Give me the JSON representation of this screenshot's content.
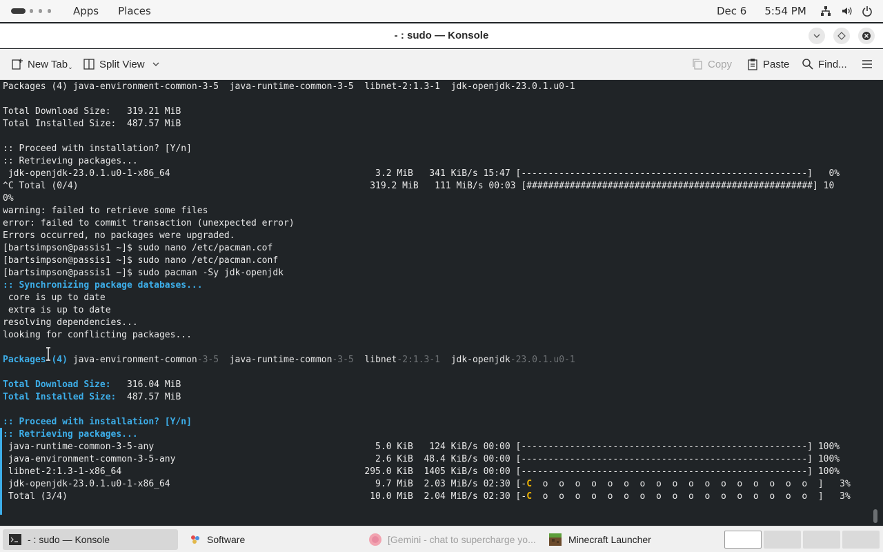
{
  "top_panel": {
    "apps_label": "Apps",
    "places_label": "Places",
    "date": "Dec 6",
    "time": "5:54 PM"
  },
  "window": {
    "title": "- : sudo — Konsole"
  },
  "toolbar": {
    "new_tab": "New Tab",
    "split_view": "Split View",
    "copy": "Copy",
    "paste": "Paste",
    "find": "Find..."
  },
  "terminal": {
    "lines": [
      [
        {
          "t": "Packages (4) java-environment-common-3-5  java-runtime-common-3-5  libnet-2:1.3-1  jdk-openjdk-23.0.1.u0-1"
        }
      ],
      [
        {
          "t": ""
        }
      ],
      [
        {
          "t": "Total Download Size:   319.21 MiB"
        }
      ],
      [
        {
          "t": "Total Installed Size:  487.57 MiB"
        }
      ],
      [
        {
          "t": ""
        }
      ],
      [
        {
          "t": ":: Proceed with installation? [Y/n]"
        }
      ],
      [
        {
          "t": ":: Retrieving packages..."
        }
      ],
      [
        {
          "t": " jdk-openjdk-23.0.1.u0-1-x86_64                                      3.2 MiB   341 KiB/s 15:47 [-----------------------------------------------------]   0%"
        }
      ],
      [
        {
          "t": "^C Total (0/4)                                                      319.2 MiB   111 MiB/s 00:03 [#####################################################] 10"
        }
      ],
      [
        {
          "t": "0%"
        }
      ],
      [
        {
          "t": "warning: failed to retrieve some files"
        }
      ],
      [
        {
          "t": "error: failed to commit transaction (unexpected error)"
        }
      ],
      [
        {
          "t": "Errors occurred, no packages were upgraded."
        }
      ],
      [
        {
          "t": "[bartsimpson@passis1 ~]$ sudo nano /etc/pacman.cof"
        }
      ],
      [
        {
          "t": "[bartsimpson@passis1 ~]$ sudo nano /etc/pacman.conf"
        }
      ],
      [
        {
          "t": "[bartsimpson@passis1 ~]$ sudo pacman -Sy jdk-openjdk"
        }
      ],
      [
        {
          "t": ":: Synchronizing package databases...",
          "c": "b"
        }
      ],
      [
        {
          "t": " core is up to date"
        }
      ],
      [
        {
          "t": " extra is up to date"
        }
      ],
      [
        {
          "t": "resolving dependencies..."
        }
      ],
      [
        {
          "t": "looking for conflicting packages..."
        }
      ],
      [
        {
          "t": ""
        }
      ],
      [
        {
          "t": "Packages (4) ",
          "c": "b"
        },
        {
          "t": "java-environment-common"
        },
        {
          "t": "-3-5",
          "c": "d"
        },
        {
          "t": "  java-runtime-common"
        },
        {
          "t": "-3-5",
          "c": "d"
        },
        {
          "t": "  libnet"
        },
        {
          "t": "-2:1.3-1",
          "c": "d"
        },
        {
          "t": "  jdk-openjdk"
        },
        {
          "t": "-23.0.1.u0-1",
          "c": "d"
        }
      ],
      [
        {
          "t": ""
        }
      ],
      [
        {
          "t": "Total Download Size:",
          "c": "b"
        },
        {
          "t": "   316.04 MiB"
        }
      ],
      [
        {
          "t": "Total Installed Size:",
          "c": "b"
        },
        {
          "t": "  487.57 MiB"
        }
      ],
      [
        {
          "t": ""
        }
      ],
      [
        {
          "t": ":: Proceed with installation? [Y/n]",
          "c": "b"
        }
      ],
      [
        {
          "t": ":: Retrieving packages...",
          "c": "b"
        }
      ],
      [
        {
          "t": " java-runtime-common-3-5-any                                         5.0 KiB   124 KiB/s 00:00 [-----------------------------------------------------] 100%"
        }
      ],
      [
        {
          "t": " java-environment-common-3-5-any                                     2.6 KiB  48.4 KiB/s 00:00 [-----------------------------------------------------] 100%"
        }
      ],
      [
        {
          "t": " libnet-2:1.3-1-x86_64                                             295.0 KiB  1405 KiB/s 00:00 [-----------------------------------------------------] 100%"
        }
      ],
      [
        {
          "t": " jdk-openjdk-23.0.1.u0-1-x86_64                                      9.7 MiB  2.03 MiB/s 02:30 [-"
        },
        {
          "t": "C",
          "c": "y"
        },
        {
          "t": "  o  o  o  o  o  o  o  o  o  o  o  o  o  o  o  o  o  ]   3%"
        }
      ],
      [
        {
          "t": " Total (3/4)                                                        10.0 MiB  2.04 MiB/s 02:30 [-"
        },
        {
          "t": "C",
          "c": "y"
        },
        {
          "t": "  o  o  o  o  o  o  o  o  o  o  o  o  o  o  o  o  o  ]   3%"
        }
      ]
    ]
  },
  "taskbar": {
    "tasks": [
      {
        "label": "- : sudo — Konsole",
        "icon": "terminal-icon"
      },
      {
        "label": "Software",
        "icon": "software-icon"
      },
      {
        "label": "[Gemini - chat to supercharge yo...",
        "icon": "firefox-icon"
      },
      {
        "label": "Minecraft Launcher",
        "icon": "minecraft-icon"
      }
    ]
  }
}
